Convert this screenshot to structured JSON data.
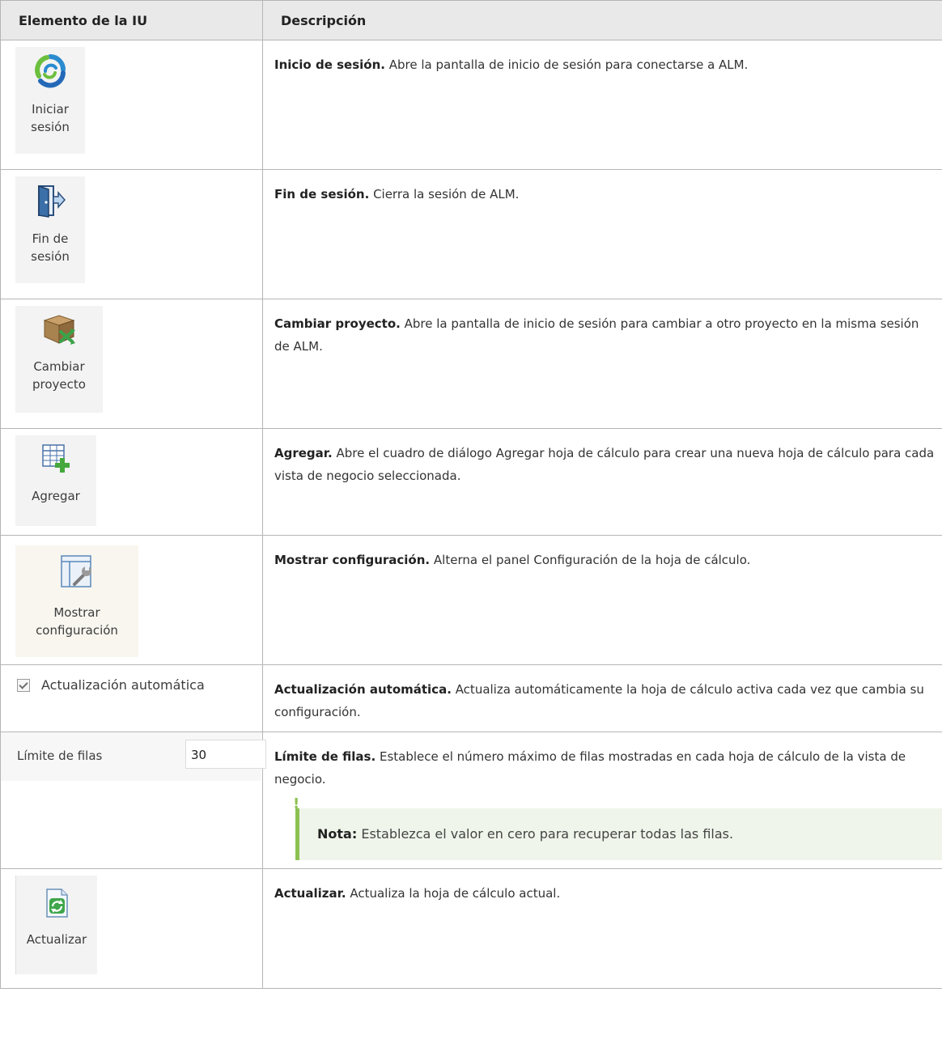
{
  "table": {
    "header_element": "Elemento de la IU",
    "header_description": "Descripción"
  },
  "rows": [
    {
      "icon": "login-icon",
      "button_label_1": "Iniciar",
      "button_label_2": "sesión",
      "title": "Inicio de sesión.",
      "text": "Abre la pantalla de inicio de sesión para conectarse a ALM."
    },
    {
      "icon": "logout-door-icon",
      "button_label_1": "Fin de",
      "button_label_2": "sesión",
      "title": "Fin de sesión.",
      "text": "Cierra la sesión de ALM."
    },
    {
      "icon": "change-project-box-icon",
      "button_label_1": "Cambiar",
      "button_label_2": "proyecto",
      "title": "Cambiar proyecto.",
      "text": "Abre la pantalla de inicio de sesión para cambiar a otro proyecto en la misma sesión de ALM."
    },
    {
      "icon": "add-sheet-icon",
      "button_label_1": "Agregar",
      "title": "Agregar.",
      "text": "Abre el cuadro de diálogo Agregar hoja de cálculo para crear una nueva hoja de cálculo para cada vista de negocio seleccionada."
    },
    {
      "icon": "show-settings-icon",
      "button_label_1": "Mostrar",
      "button_label_2": "configuración",
      "title": "Mostrar configuración.",
      "text": "Alterna el panel Configuración de la hoja de cálculo."
    },
    {
      "icon": "checkbox-checked-icon",
      "checkbox_label": "Actualización automática",
      "checked": true,
      "title": "Actualización automática.",
      "text": "Actualiza automáticamente la hoja de cálculo activa cada vez que cambia su configuración."
    },
    {
      "field_label": "Límite de filas",
      "field_value": "30",
      "title": "Límite de filas.",
      "text": "Establece el número máximo de filas mostradas en cada hoja de cálculo de la vista de negocio.",
      "note_title": "Nota:",
      "note_text": "Establezca el valor en cero para recuperar todas las filas."
    },
    {
      "icon": "refresh-icon",
      "button_label_1": "Actualizar",
      "title": "Actualizar.",
      "text": "Actualiza la hoja de cálculo actual."
    }
  ],
  "colors": {
    "header_bg": "#e9e9e9",
    "border": "#b5b5b5",
    "note_bg": "#eff5ea",
    "note_accent": "#8cc152"
  }
}
